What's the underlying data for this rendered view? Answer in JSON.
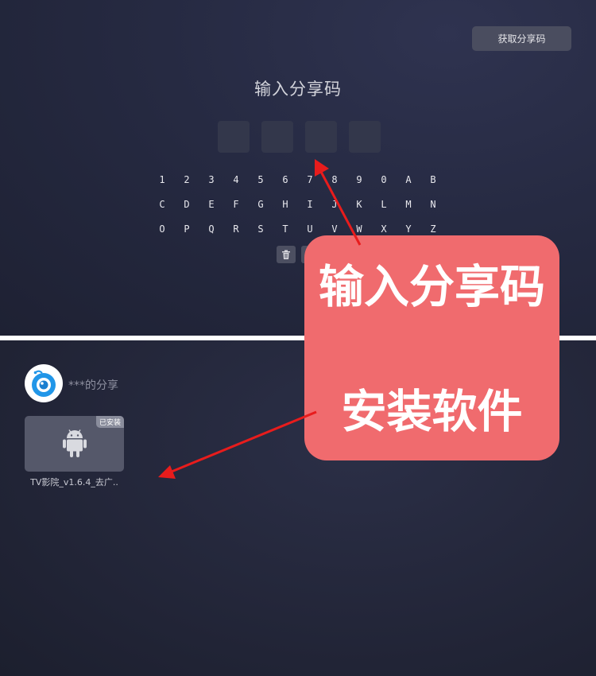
{
  "header": {
    "get_code_label": "获取分享码"
  },
  "code_entry": {
    "title": "输入分享码",
    "boxes": [
      "",
      "",
      "",
      ""
    ]
  },
  "keyboard": {
    "rows": [
      [
        "1",
        "2",
        "3",
        "4",
        "5",
        "6",
        "7",
        "8",
        "9",
        "0",
        "A",
        "B"
      ],
      [
        "C",
        "D",
        "E",
        "F",
        "G",
        "H",
        "I",
        "J",
        "K",
        "L",
        "M",
        "N"
      ],
      [
        "O",
        "P",
        "Q",
        "R",
        "S",
        "T",
        "U",
        "V",
        "W",
        "X",
        "Y",
        "Z"
      ]
    ],
    "functions": [
      {
        "name": "delete",
        "icon": "trash-icon"
      },
      {
        "name": "clear",
        "icon": "key-icon"
      }
    ]
  },
  "share": {
    "owner_label": "***的分享",
    "avatar_icon": "camera-logo-icon",
    "apps": [
      {
        "name": "TV影院_v1.6.4_去广..",
        "badge": "已安装",
        "icon": "android-icon"
      }
    ]
  },
  "annotation": {
    "line1": "输入分享码",
    "line2": "安装软件",
    "bg_color": "#f06b6e",
    "arrow_color": "#e81c1c"
  },
  "colors": {
    "divider": "#ffffff",
    "background": "#1f2235"
  }
}
